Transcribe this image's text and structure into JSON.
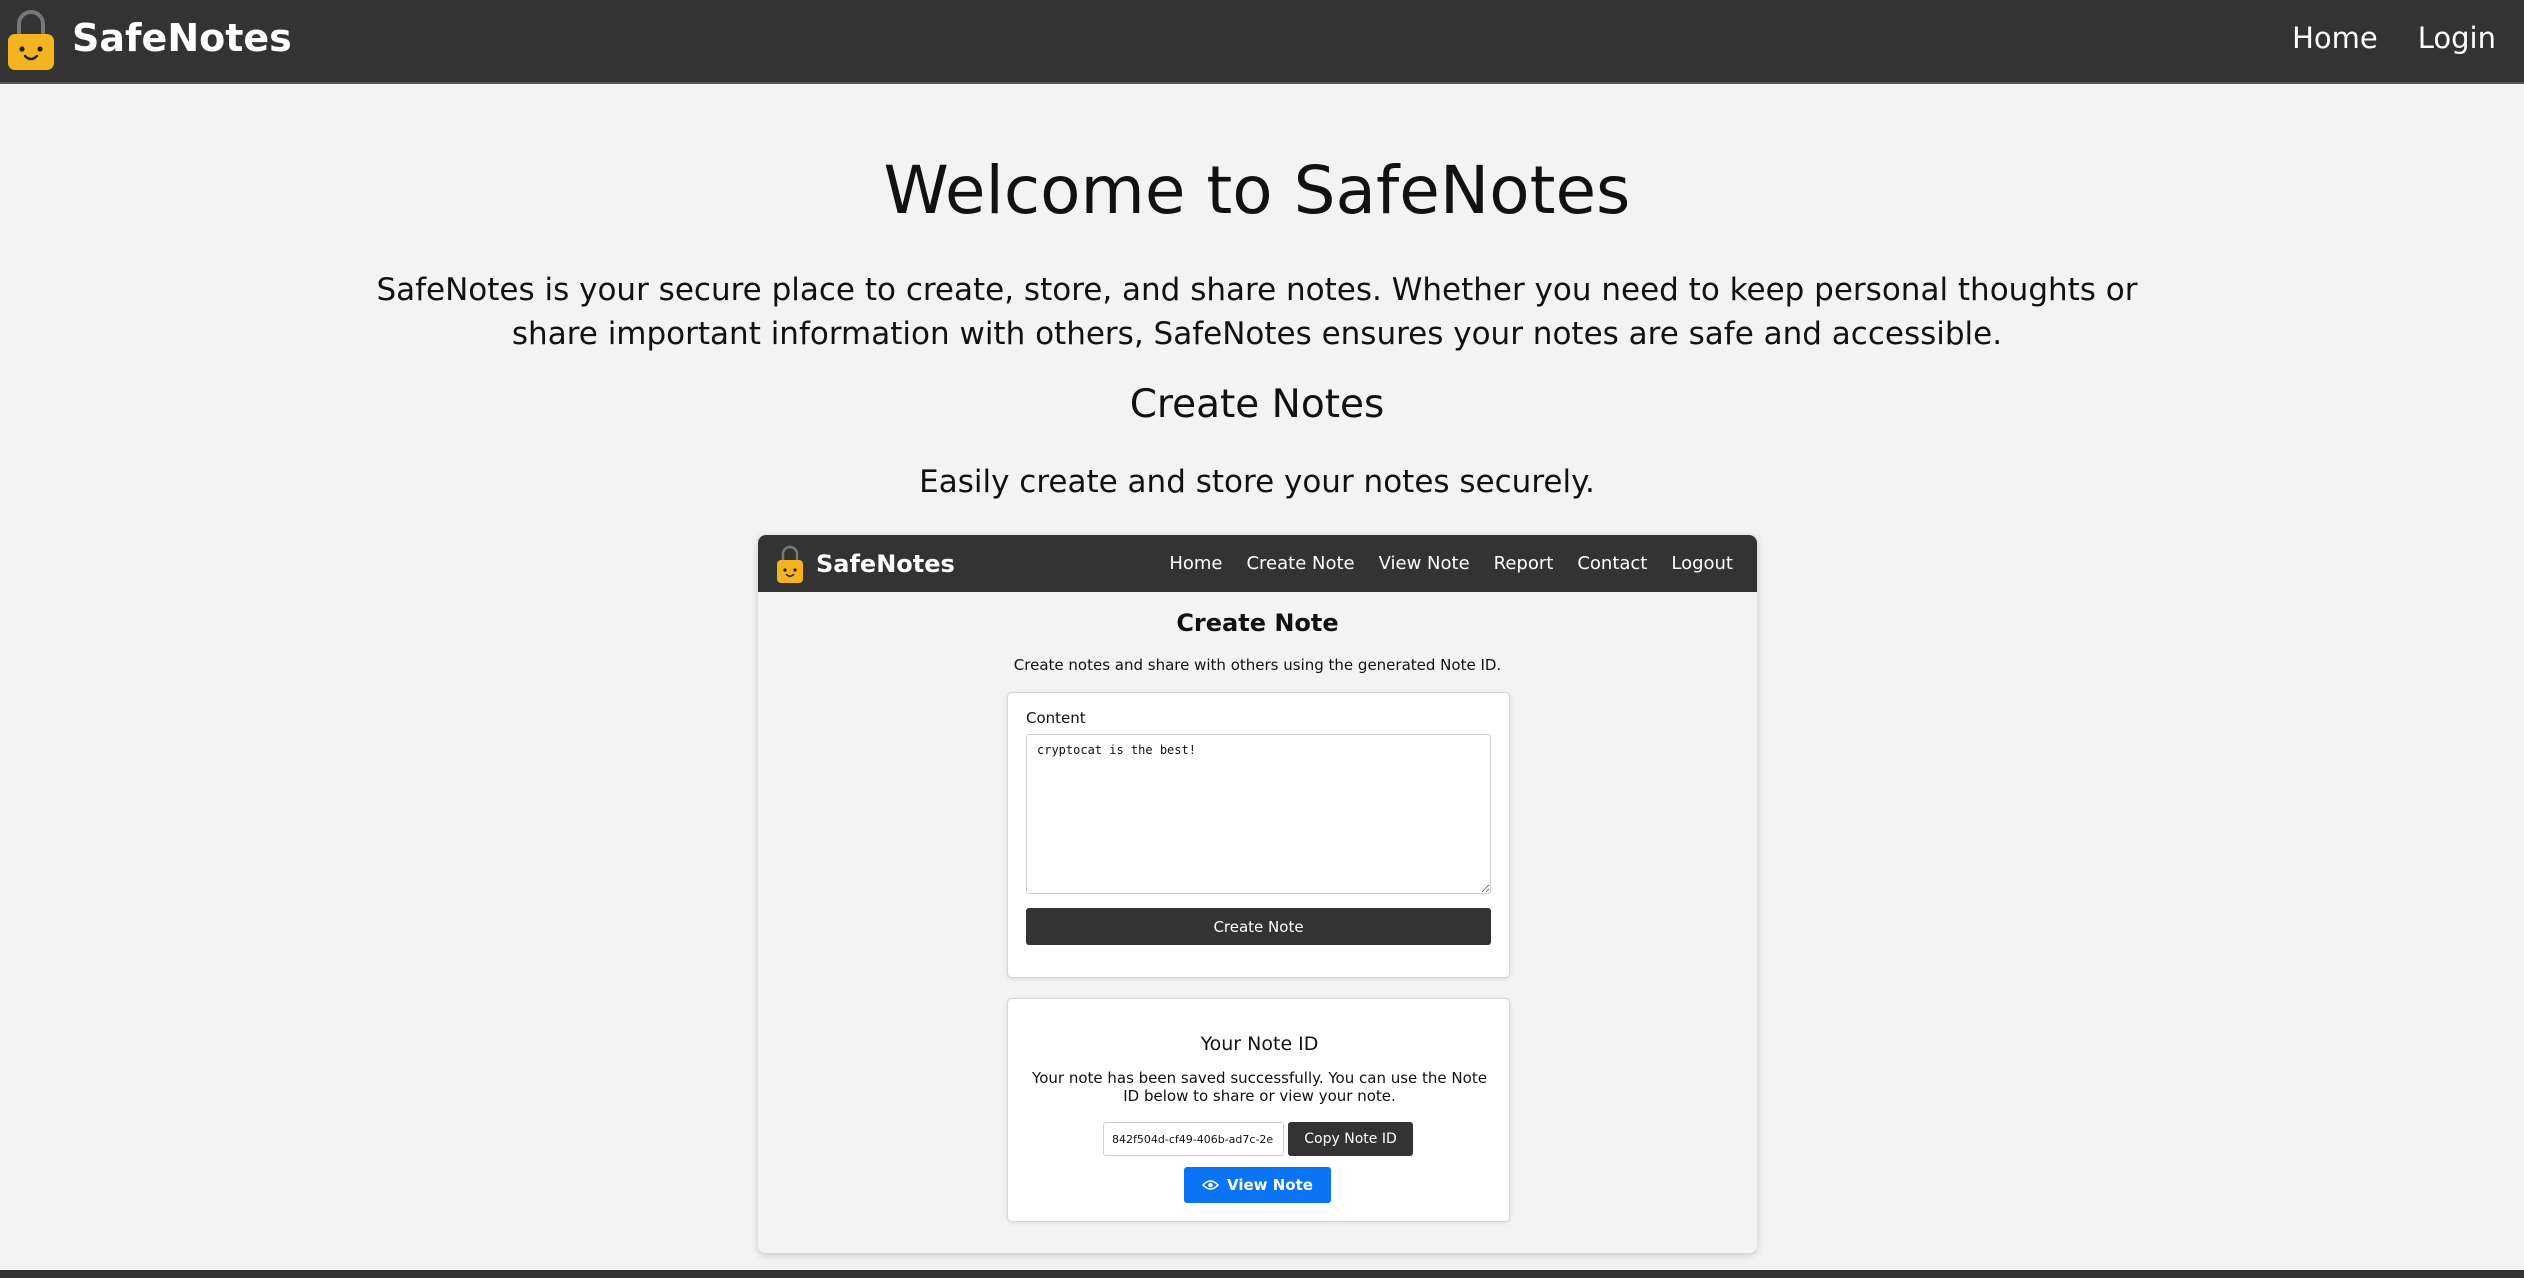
{
  "colors": {
    "navbar": "#333333",
    "page_bg": "#f3f3f3",
    "accent_blue": "#0a74f5",
    "lock_body": "#f4b321",
    "lock_shackle": "#777777"
  },
  "header": {
    "brand": "SafeNotes",
    "logo_icon": "lock-icon",
    "nav": [
      {
        "label": "Home"
      },
      {
        "label": "Login"
      }
    ]
  },
  "hero": {
    "title": "Welcome to SafeNotes",
    "description": "SafeNotes is your secure place to create, store, and share notes. Whether you need to keep personal thoughts or share important information with others, SafeNotes ensures your notes are safe and accessible.",
    "section_title": "Create Notes",
    "section_description": "Easily create and store your notes securely."
  },
  "preview": {
    "brand": "SafeNotes",
    "nav": [
      {
        "label": "Home"
      },
      {
        "label": "Create Note"
      },
      {
        "label": "View Note"
      },
      {
        "label": "Report"
      },
      {
        "label": "Contact"
      },
      {
        "label": "Logout"
      }
    ],
    "heading": "Create Note",
    "subheading": "Create notes and share with others using the generated Note ID.",
    "form": {
      "content_label": "Content",
      "content_value": "cryptocat is the best!",
      "submit_label": "Create Note"
    },
    "result": {
      "title": "Your Note ID",
      "message": "Your note has been saved successfully. You can use the Note ID below to share or view your note.",
      "note_id_value": "842f504d-cf49-406b-ad7c-2e",
      "copy_label": "Copy Note ID",
      "view_label": "View Note",
      "view_icon": "eye-icon"
    }
  }
}
